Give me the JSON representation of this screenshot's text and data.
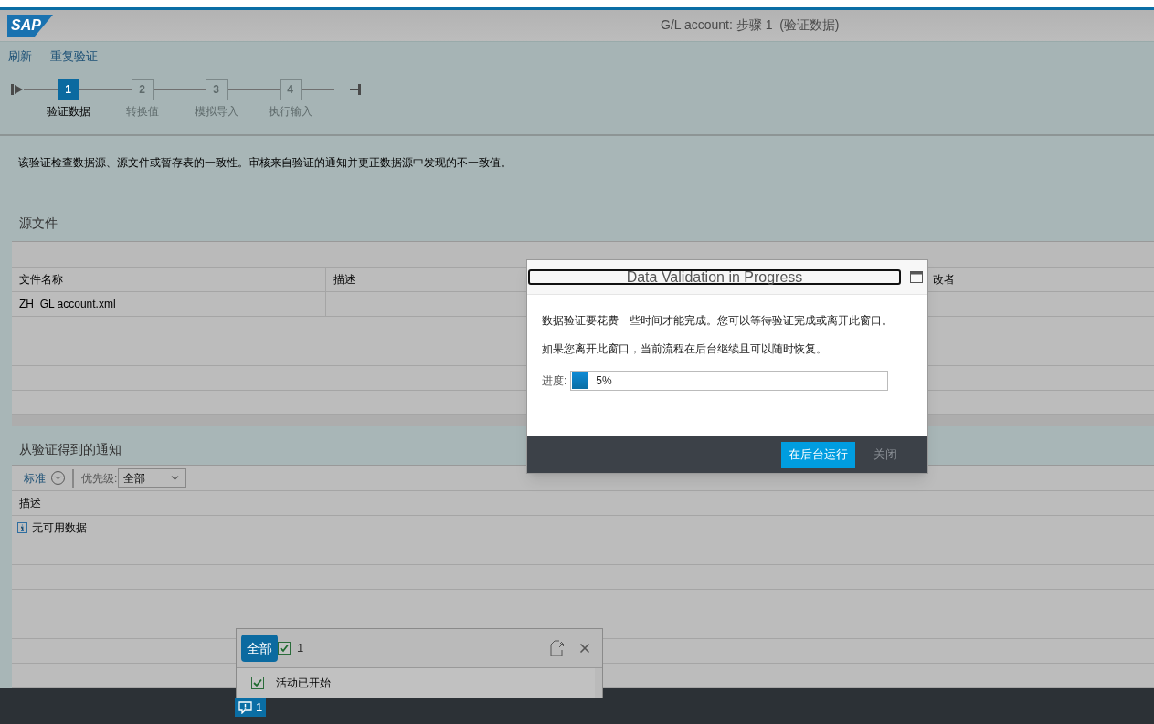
{
  "header": {
    "logo": "SAP",
    "title": "G/L account: 步骤 1  (验证数据)"
  },
  "toolbar": [
    "刷新",
    "重复验证"
  ],
  "steps": [
    {
      "number": "1",
      "label": "验证数据",
      "selected": true
    },
    {
      "number": "2",
      "label": "转换值",
      "selected": false
    },
    {
      "number": "3",
      "label": "模拟导入",
      "selected": false
    },
    {
      "number": "4",
      "label": "执行输入",
      "selected": false
    }
  ],
  "description": "该验证检查数据源、源文件或暂存表的一致性。审核来自验证的通知并更正数据源中发现的不一致值。",
  "source_files": {
    "title": "源文件",
    "columns": [
      "文件名称",
      "描述",
      "改者"
    ],
    "rows": [
      {
        "file_name": "ZH_GL account.xml"
      }
    ]
  },
  "notifications": {
    "title": "从验证得到的通知",
    "variant": "标准",
    "priority_label": "优先级:",
    "priority_value": "全部",
    "columns": [
      "描述"
    ],
    "rows": [
      {
        "kind": "info",
        "text": "无可用数据"
      }
    ]
  },
  "dialog": {
    "title": "Data Validation in Progress",
    "paragraphs": [
      "数据验证要花费一些时间才能完成。您可以等待验证完成或离开此窗口。",
      "如果您离开此窗口，当前流程在后台继续且可以随时恢复。"
    ],
    "progress_label": "进度:",
    "progress": {
      "level": 0.05,
      "reading": "5%"
    },
    "buttons": [
      {
        "label": "在后台运行",
        "kind": "primary"
      },
      {
        "label": "关闭",
        "kind": "secondary"
      }
    ]
  },
  "message_popover": {
    "filter": "全部",
    "success_count": "1",
    "items": [
      {
        "kind": "success",
        "text": "活动已开始"
      }
    ]
  },
  "status_bar": {
    "message_count": "1"
  }
}
